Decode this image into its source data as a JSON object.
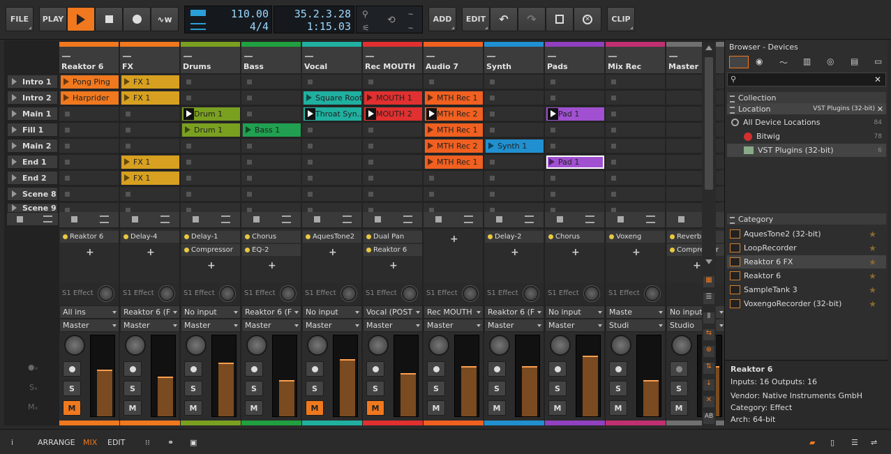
{
  "toolbar": {
    "file": "FILE",
    "play": "PLAY",
    "add": "ADD",
    "edit": "EDIT",
    "clip": "CLIP",
    "tempo": "110.00",
    "time_sig": "4/4",
    "position": "35.2.3.28",
    "time": "1:15.03"
  },
  "tracks": [
    {
      "name": "Reaktor 6",
      "color": "#f0781e",
      "clips": [
        {
          "row": 0,
          "label": "Pong Ping",
          "color": "#f0781e"
        },
        {
          "row": 1,
          "label": "Harprider",
          "color": "#f0781e"
        }
      ],
      "devices": [
        "Reaktor 6"
      ],
      "fx": "S1 Effect",
      "input": "All ins",
      "output": "Master",
      "mute": true,
      "solo": "S",
      "mute_label": "M",
      "meter": 0.65
    },
    {
      "name": "FX",
      "color": "#f0781e",
      "clips": [
        {
          "row": 0,
          "label": "FX 1",
          "color": "#d8a020"
        },
        {
          "row": 1,
          "label": "FX 1",
          "color": "#d8a020"
        },
        {
          "row": 5,
          "label": "FX 1",
          "color": "#d8a020"
        },
        {
          "row": 6,
          "label": "FX 1",
          "color": "#d8a020"
        }
      ],
      "devices": [
        "Delay-4"
      ],
      "fx": "S1 Effect",
      "input": "Reaktor 6 (F",
      "output": "Master",
      "mute": false,
      "solo": "S",
      "mute_label": "M",
      "meter": 0.55
    },
    {
      "name": "Drums",
      "color": "#7aa020",
      "clips": [
        {
          "row": 2,
          "label": "Drum 1",
          "color": "#7aa020",
          "play": true
        },
        {
          "row": 3,
          "label": "Drum 1",
          "color": "#7aa020"
        }
      ],
      "devices": [
        "Delay-1",
        "Compressor"
      ],
      "fx": "S1 Effect",
      "input": "No input",
      "output": "Master",
      "mute": false,
      "solo": "S",
      "mute_label": "M",
      "meter": 0.75
    },
    {
      "name": "Bass",
      "color": "#20a040",
      "clips": [
        {
          "row": 3,
          "label": "Bass 1",
          "color": "#20a050"
        }
      ],
      "devices": [
        "Chorus",
        "EQ-2"
      ],
      "fx": "S1 Effect",
      "input": "Reaktor 6 (F",
      "output": "Master",
      "mute": false,
      "solo": "S",
      "mute_label": "M",
      "meter": 0.5
    },
    {
      "name": "Vocal",
      "color": "#20b0a0",
      "clips": [
        {
          "row": 1,
          "label": "Square Root",
          "color": "#20b0a0"
        },
        {
          "row": 2,
          "label": "Throat Syn...",
          "color": "#20b0a0",
          "play": true
        }
      ],
      "devices": [
        "AquesTone2"
      ],
      "fx": "S1 Effect",
      "input": "No input",
      "output": "Master",
      "mute": true,
      "solo": "S",
      "mute_label": "M",
      "meter": 0.8
    },
    {
      "name": "Rec MOUTH",
      "color": "#e03030",
      "clips": [
        {
          "row": 1,
          "label": "MOUTH 1",
          "color": "#e03030"
        },
        {
          "row": 2,
          "label": "MOUTH 2",
          "color": "#e03030",
          "play": true
        }
      ],
      "devices": [
        "Dual Pan",
        "Reaktor 6"
      ],
      "fx": "S1 Effect",
      "input": "Vocal (POST",
      "output": "Master",
      "mute": true,
      "solo": "S",
      "mute_label": "M",
      "meter": 0.6
    },
    {
      "name": "Audio 7",
      "color": "#f06020",
      "clips": [
        {
          "row": 1,
          "label": "MTH Rec 1",
          "color": "#f06020"
        },
        {
          "row": 2,
          "label": "MTH Rec 2",
          "color": "#f06020",
          "play": true
        },
        {
          "row": 3,
          "label": "MTH Rec 1",
          "color": "#f06020"
        },
        {
          "row": 4,
          "label": "MTH Rec 2",
          "color": "#f06020"
        },
        {
          "row": 5,
          "label": "MTH Rec 1",
          "color": "#f06020"
        }
      ],
      "devices": [],
      "fx": "S1 Effect",
      "input": "Rec MOUTH",
      "output": "Master",
      "mute": false,
      "solo": "S",
      "mute_label": "M",
      "meter": 0.7
    },
    {
      "name": "Synth",
      "color": "#2090d0",
      "clips": [
        {
          "row": 4,
          "label": "Synth 1",
          "color": "#2090d0"
        }
      ],
      "devices": [
        "Delay-2"
      ],
      "fx": "S1 Effect",
      "input": "Reaktor 6 (F",
      "output": "Master",
      "mute": false,
      "solo": "S",
      "mute_label": "M",
      "meter": 0.7
    },
    {
      "name": "Pads",
      "color": "#9040c0",
      "clips": [
        {
          "row": 2,
          "label": "Pad 1",
          "color": "#a050d0",
          "play": true
        },
        {
          "row": 5,
          "label": "Pad 1",
          "color": "#a050d0",
          "sel": true
        }
      ],
      "devices": [
        "Chorus"
      ],
      "fx": "S1 Effect",
      "input": "No input",
      "output": "Master",
      "mute": false,
      "solo": "S",
      "mute_label": "M",
      "meter": 0.85
    },
    {
      "name": "Mix Rec",
      "color": "#c03070",
      "clips": [],
      "devices": [
        "Voxeng"
      ],
      "fx": "S1 Effect",
      "input": "Maste",
      "output": "Studi",
      "mute": false,
      "solo": "S",
      "mute_label": "M",
      "meter": 0.5
    },
    {
      "name": "Master",
      "color": "#707070",
      "clips": [],
      "devices": [
        "Reverb",
        "Compressor"
      ],
      "fx": "",
      "input": "No input",
      "output": "Studio",
      "mute": false,
      "solo": "S",
      "mute_label": "M",
      "meter": 0.7
    }
  ],
  "scenes": [
    "Intro 1",
    "Intro 2",
    "Main 1",
    "Fill 1",
    "Main 2",
    "End 1",
    "End 2",
    "Scene 8",
    "Scene 9"
  ],
  "browser": {
    "title": "Browser - Devices",
    "collection": "Collection",
    "location": "Location",
    "location_value": "VST Plugins (32-bit)",
    "locations": [
      {
        "label": "All Device Locations",
        "count": "84"
      },
      {
        "label": "Bitwig",
        "count": "78"
      },
      {
        "label": "VST Plugins (32-bit)",
        "count": "6"
      }
    ],
    "category": "Category",
    "devices": [
      "AquesTone2 (32-bit)",
      "LoopRecorder",
      "Reaktor 6 FX",
      "Reaktor 6",
      "SampleTank 3",
      "VoxengoRecorder (32-bit)"
    ],
    "info": {
      "name": "Reaktor 6",
      "io": "Inputs: 16   Outputs: 16",
      "vendor": "Vendor: Native Instruments GmbH",
      "category": "Category: Effect",
      "arch": "Arch: 64-bit"
    }
  },
  "status": {
    "arrange": "ARRANGE",
    "mix": "MIX",
    "edit": "EDIT"
  }
}
